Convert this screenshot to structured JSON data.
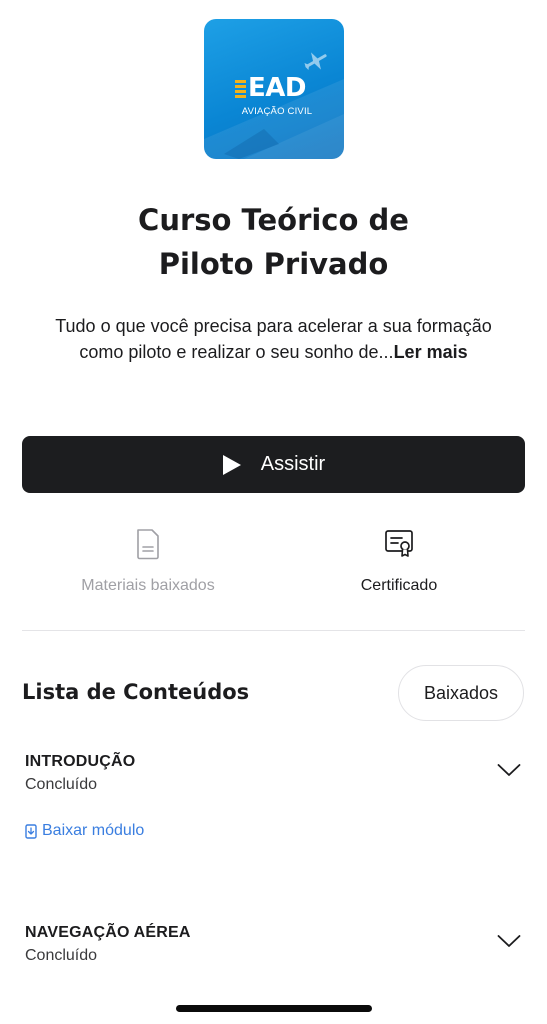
{
  "course": {
    "logo": {
      "brand": "EAD",
      "subtitle": "AVIAÇÃO CIVIL",
      "colors": {
        "bg": "#0a86d4",
        "accent": "#f2b21c"
      }
    },
    "title_line1": "Curso Teórico de",
    "title_line2": "Piloto Privado",
    "description": "Tudo o que você precisa para acelerar a sua formação como piloto e realizar o seu sonho de...",
    "read_more": "Ler mais"
  },
  "watch_button": {
    "label": "Assistir",
    "icon": "play-icon"
  },
  "actions": [
    {
      "label": "Materiais baixados",
      "icon": "document-icon",
      "enabled": false
    },
    {
      "label": "Certificado",
      "icon": "certificate-icon",
      "enabled": true
    }
  ],
  "content_list": {
    "title": "Lista de Conteúdos",
    "downloaded_button": "Baixados",
    "modules": [
      {
        "title": "INTRODUÇÃO",
        "status": "Concluído",
        "download_label": "Baixar módulo"
      },
      {
        "title": "NAVEGAÇÃO AÉREA",
        "status": "Concluído"
      }
    ]
  },
  "colors": {
    "primary_button": "#1c1d1f",
    "link": "#3a7ee0",
    "disabled_text": "#a0a0a5"
  }
}
